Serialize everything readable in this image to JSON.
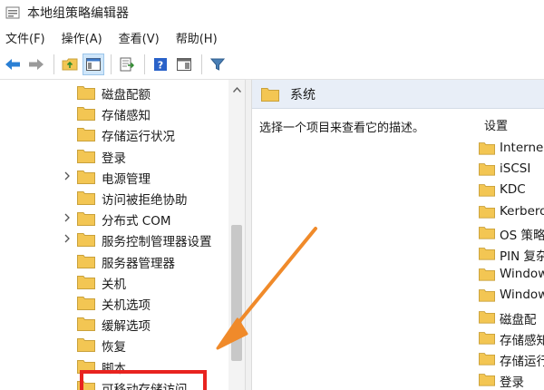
{
  "window": {
    "title": "本地组策略编辑器"
  },
  "menu": {
    "items": [
      "文件(F)",
      "操作(A)",
      "查看(V)",
      "帮助(H)"
    ]
  },
  "tree": {
    "items": [
      {
        "label": "磁盘配额",
        "expandable": false
      },
      {
        "label": "存储感知",
        "expandable": false
      },
      {
        "label": "存储运行状况",
        "expandable": false
      },
      {
        "label": "登录",
        "expandable": false
      },
      {
        "label": "电源管理",
        "expandable": true
      },
      {
        "label": "访问被拒绝协助",
        "expandable": false
      },
      {
        "label": "分布式 COM",
        "expandable": true
      },
      {
        "label": "服务控制管理器设置",
        "expandable": true
      },
      {
        "label": "服务器管理器",
        "expandable": false
      },
      {
        "label": "关机",
        "expandable": false
      },
      {
        "label": "关机选项",
        "expandable": false
      },
      {
        "label": "缓解选项",
        "expandable": false
      },
      {
        "label": "恢复",
        "expandable": false
      },
      {
        "label": "脚本",
        "expandable": false
      },
      {
        "label": "可移动存储访问",
        "expandable": false
      }
    ]
  },
  "details": {
    "header_title": "系统",
    "description": "选择一个项目来查看它的描述。",
    "settings_header": "设置",
    "settings": [
      "Interne",
      "iSCSI",
      "KDC",
      "Kerbero",
      "OS 策略",
      "PIN 复杂",
      "Window",
      "Window",
      "磁盘配",
      "存储感知",
      "存储运行",
      "登录"
    ]
  },
  "colors": {
    "highlight": "#e8231f",
    "arrow": "#f08a2a",
    "folder": "#f3c653"
  }
}
